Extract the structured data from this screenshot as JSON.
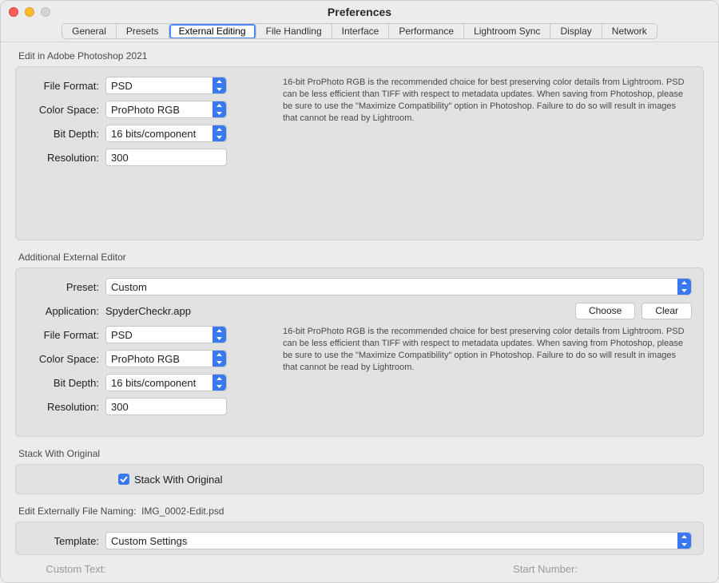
{
  "window": {
    "title": "Preferences"
  },
  "tabs": {
    "items": [
      "General",
      "Presets",
      "External Editing",
      "File Handling",
      "Interface",
      "Performance",
      "Lightroom Sync",
      "Display",
      "Network"
    ],
    "active_index": 2
  },
  "section1": {
    "title": "Edit in Adobe Photoshop 2021",
    "file_format": {
      "label": "File Format:",
      "value": "PSD"
    },
    "color_space": {
      "label": "Color Space:",
      "value": "ProPhoto RGB"
    },
    "bit_depth": {
      "label": "Bit Depth:",
      "value": "16 bits/component"
    },
    "resolution": {
      "label": "Resolution:",
      "value": "300"
    },
    "help": "16-bit ProPhoto RGB is the recommended choice for best preserving color details from Lightroom. PSD can be less efficient than TIFF with respect to metadata updates. When saving from Photoshop, please be sure to use the \"Maximize Compatibility\" option in Photoshop. Failure to do so will result in images that cannot be read by Lightroom."
  },
  "section2": {
    "title": "Additional External Editor",
    "preset": {
      "label": "Preset:",
      "value": "Custom"
    },
    "application": {
      "label": "Application:",
      "value": "SpyderCheckr.app"
    },
    "choose_label": "Choose",
    "clear_label": "Clear",
    "file_format": {
      "label": "File Format:",
      "value": "PSD"
    },
    "color_space": {
      "label": "Color Space:",
      "value": "ProPhoto RGB"
    },
    "bit_depth": {
      "label": "Bit Depth:",
      "value": "16 bits/component"
    },
    "resolution": {
      "label": "Resolution:",
      "value": "300"
    },
    "help": "16-bit ProPhoto RGB is the recommended choice for best preserving color details from Lightroom. PSD can be less efficient than TIFF with respect to metadata updates. When saving from Photoshop, please be sure to use the \"Maximize Compatibility\" option in Photoshop. Failure to do so will result in images that cannot be read by Lightroom."
  },
  "section3": {
    "title": "Stack With Original",
    "checkbox_label": "Stack With Original",
    "checked": true
  },
  "section4": {
    "title_prefix": "Edit Externally File Naming:",
    "example": "IMG_0002-Edit.psd",
    "template": {
      "label": "Template:",
      "value": "Custom Settings"
    },
    "custom_text_label": "Custom Text:",
    "start_number_label": "Start Number:"
  }
}
